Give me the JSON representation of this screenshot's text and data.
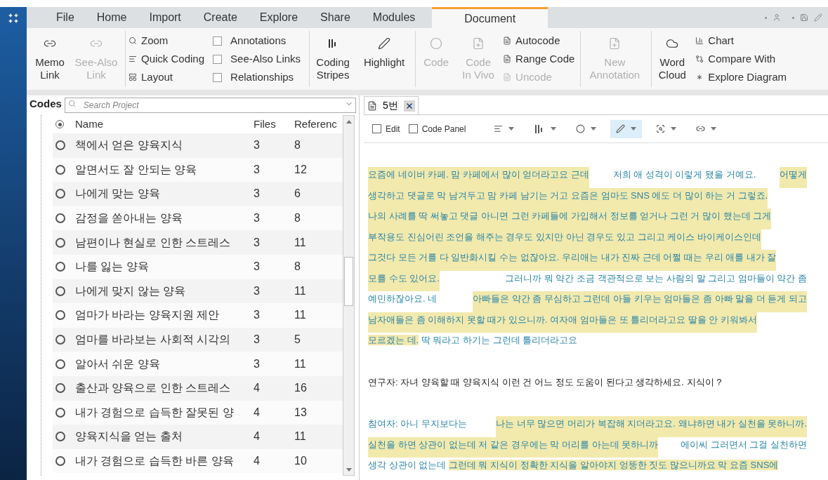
{
  "menu_tabs": [
    {
      "label": "File",
      "selected": false
    },
    {
      "label": "Home",
      "selected": false
    },
    {
      "label": "Import",
      "selected": false
    },
    {
      "label": "Create",
      "selected": false
    },
    {
      "label": "Explore",
      "selected": false
    },
    {
      "label": "Share",
      "selected": false
    },
    {
      "label": "Modules",
      "selected": false
    },
    {
      "label": "Document",
      "selected": true
    }
  ],
  "ribbon": {
    "groups": [
      {
        "items": [
          {
            "kind": "large",
            "label": "Memo Link",
            "disabled": false
          },
          {
            "kind": "large",
            "label": "See-Also Link",
            "disabled": true
          }
        ]
      },
      {
        "items": [
          {
            "kind": "stack",
            "entries": [
              {
                "label": "Zoom",
                "disabled": false
              },
              {
                "label": "Quick Coding",
                "disabled": false
              },
              {
                "label": "Layout",
                "disabled": false
              }
            ]
          },
          {
            "kind": "checks",
            "entries": [
              {
                "label": "Annotations",
                "checked": false
              },
              {
                "label": "See-Also Links",
                "checked": false
              },
              {
                "label": "Relationships",
                "checked": false
              }
            ]
          }
        ]
      },
      {
        "items": [
          {
            "kind": "large",
            "label": "Coding Stripes",
            "disabled": false
          },
          {
            "kind": "large",
            "label": "Highlight",
            "disabled": false
          }
        ]
      },
      {
        "items": [
          {
            "kind": "large",
            "label": "Code",
            "disabled": true
          },
          {
            "kind": "large",
            "label": "Code In Vivo",
            "disabled": true
          },
          {
            "kind": "stack",
            "entries": [
              {
                "label": "Autocode",
                "disabled": false
              },
              {
                "label": "Range Code",
                "disabled": false
              },
              {
                "label": "Uncode",
                "disabled": true
              }
            ]
          }
        ]
      },
      {
        "items": [
          {
            "kind": "large",
            "label": "New Annotation",
            "disabled": true
          }
        ]
      },
      {
        "items": [
          {
            "kind": "large",
            "label": "Word Cloud",
            "disabled": false
          },
          {
            "kind": "stack",
            "entries": [
              {
                "label": "Chart",
                "disabled": false
              },
              {
                "label": "Compare With",
                "disabled": false
              },
              {
                "label": "Explore Diagram",
                "disabled": false
              }
            ]
          }
        ]
      }
    ]
  },
  "codes_panel": {
    "title": "Codes",
    "search": {
      "placeholder": "Search Project"
    },
    "columns": [
      "Name",
      "Files",
      "Referenc"
    ],
    "rows": [
      {
        "name": "책에서 얻은 양육지식",
        "files": "3",
        "references": "8"
      },
      {
        "name": "알면서도 잘 안되는 양육",
        "files": "3",
        "references": "12"
      },
      {
        "name": "나에게 맞는 양육",
        "files": "3",
        "references": "6"
      },
      {
        "name": "감정을 쏟아내는 양육",
        "files": "3",
        "references": "8"
      },
      {
        "name": "남편이나 현실로 인한 스트레스",
        "files": "3",
        "references": "11"
      },
      {
        "name": "나를 잃는 양육",
        "files": "3",
        "references": "8"
      },
      {
        "name": "나에게 맞지 않는 양육",
        "files": "3",
        "references": "11"
      },
      {
        "name": "엄마가 바라는 양육지원 제안",
        "files": "3",
        "references": "11"
      },
      {
        "name": "엄마를 바라보는 사회적 시각의",
        "files": "3",
        "references": "5"
      },
      {
        "name": "알아서 쉬운 양육",
        "files": "3",
        "references": "11"
      },
      {
        "name": "출산과 양육으로 인한 스트레스",
        "files": "4",
        "references": "16"
      },
      {
        "name": "내가 경험으로 습득한 잘못된 양",
        "files": "4",
        "references": "13"
      },
      {
        "name": "양육지식을 얻는 출처",
        "files": "4",
        "references": "11"
      },
      {
        "name": "내가 경험으로 습득한 바른 양육",
        "files": "4",
        "references": "10"
      }
    ]
  },
  "document": {
    "tab": {
      "label": "5번"
    },
    "toolbar": {
      "checks": [
        {
          "label": "Edit",
          "checked": false
        },
        {
          "label": "Code Panel",
          "checked": false
        }
      ],
      "tools": [
        {
          "kind": "annotations",
          "selected": false
        },
        {
          "kind": "stripes",
          "selected": false
        },
        {
          "kind": "code",
          "selected": false
        },
        {
          "kind": "highlight",
          "selected": true
        },
        {
          "kind": "zoom",
          "selected": false
        },
        {
          "kind": "link",
          "selected": false
        }
      ]
    },
    "paragraphs": [
      {
        "kind": "participant",
        "lines": [
          [
            {
              "text": "요즘에 네이버 카페. 맘 카페에서 많이 얻더라고요 근데",
              "highlight": true
            },
            {
              "text": " 저희 애 성격이 이렇게 됐을 거예요. ",
              "highlight": false
            },
            {
              "text": "어떻게",
              "highlight": true
            }
          ],
          [
            {
              "text": "생각하고 댓글로 막 남겨두고 맘 카페 남기는 거고 요즘은 엄마도 SNS 에도 더 많이 하는 거 그렇죠.",
              "highlight": true
            }
          ],
          [
            {
              "text": "나의 사례를 딱 써놓고 댓글 아니면 그런 카페들에 가입해서 정보를 얻거나 그런 거 많이 했는데 그게",
              "highlight": true
            }
          ],
          [
            {
              "text": "부작용도 진심어린 조언을 해주는 경우도 있지만 아닌 경우도 있고 그리고 케이스 바이케이스인데",
              "highlight": true
            }
          ],
          [
            {
              "text": "그것다 모든 거를 다 일반화시킬 수는 없잖아요. 우리애는 내가 진짜 근데 어쩔 때는 우리 애를 내가 잘",
              "highlight": true
            }
          ],
          [
            {
              "text": "모를 수도 있어요. ",
              "highlight": true
            },
            {
              "text": "그러니까 뭐 약간 조금 객관적으로 보는 사람의 말 그리고 엄마들이 약간 좀",
              "highlight": false
            }
          ],
          [
            {
              "text": "예민하잖아요. 네 ",
              "highlight": false
            },
            {
              "text": "아빠들은 약간 좀 무심하고 그런데 아들 키우는 엄마들은 좀 아빠 말을 더 듣게 되고",
              "highlight": true
            }
          ],
          [
            {
              "text": "남자애들은 좀 이해하지 못할 때가 있으니까. 여자애 엄마들은 또 틀리더라고요 딸을 안 키워봐서",
              "highlight": true
            }
          ],
          [
            {
              "text": "모르겠는 데.",
              "highlight": true
            },
            {
              "text": " 딱 뭐라고 하기는 그런데 틀리더라고요",
              "highlight": false
            }
          ]
        ]
      },
      {
        "kind": "researcher",
        "lines": [
          [
            {
              "text": "연구자: 자녀 양육할 때 양육지식 이런 건 어느 정도 도움이 된다고 생각하세요. 지식이 ?",
              "highlight": false
            }
          ]
        ]
      },
      {
        "kind": "participant",
        "lines": [
          [
            {
              "text": "참여자: 아니 무지보다는 ",
              "highlight": false
            },
            {
              "text": "나는 너무 많으면 머리가 복잡해 지더라고요. 왜냐하면 내가 실천을 못하니까.",
              "highlight": true
            }
          ],
          [
            {
              "text": "실천을 하면 상관이 없는데 저 같은 경우에는 막 머리를 아는데 못하니까",
              "highlight": true
            },
            {
              "text": " 에이씨 그러면서 그걸 실천하면",
              "highlight": false
            }
          ],
          [
            {
              "text": "생각 상관이 없는데 ",
              "highlight": false
            },
            {
              "text": "그런데 뭐 지식이 정확한 지식을 알아야지 엉뚱한 짓도 많으니까요 막 요즘 SNS에",
              "highlight": true
            }
          ]
        ]
      }
    ]
  }
}
